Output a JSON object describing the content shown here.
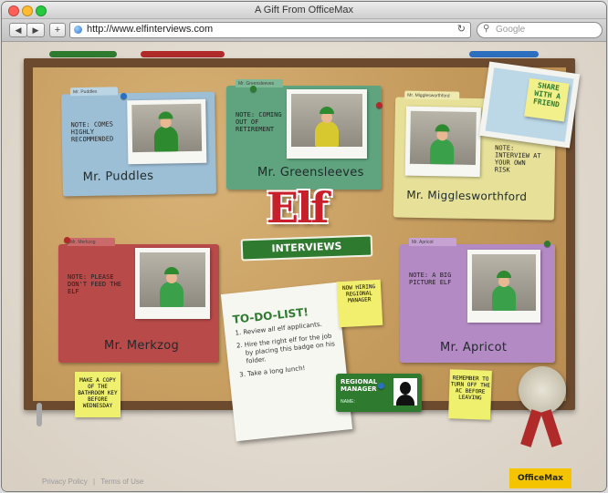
{
  "window": {
    "title": "A Gift From OfficeMax",
    "traffic_colors": [
      "#ff5f57",
      "#febc2e",
      "#28c840"
    ]
  },
  "toolbar": {
    "back_icon": "back-arrow-icon",
    "forward_icon": "forward-arrow-icon",
    "add_label": "+",
    "url": "http://www.elfinterviews.com",
    "reload_icon": "reload-icon",
    "search_placeholder": "Google"
  },
  "brand": {
    "logo_text": "Elf",
    "banner_text": "INTERVIEWS"
  },
  "share": {
    "text": "SHARE WITH A FRIEND"
  },
  "folders": [
    {
      "tab": "Mr. Puddles",
      "note": "NOTE: COMES HIGHLY RECOMMENDED",
      "name": "Mr. Puddles",
      "color": "#9dbfd6"
    },
    {
      "tab": "Mr. Greensleeves",
      "note": "NOTE: COMING OUT OF RETIREMENT",
      "name": "Mr. Greensleeves",
      "color": "#5fa47f"
    },
    {
      "tab": "Mr. Migglesworthford",
      "note": "NOTE: INTERVIEW AT YOUR OWN RISK",
      "name": "Mr. Migglesworthford",
      "color": "#e6e098"
    },
    {
      "tab": "Mr. Merkzog",
      "note": "NOTE: PLEASE DON'T FEED THE ELF",
      "name": "Mr. Merkzog",
      "color": "#b84a4a"
    },
    {
      "tab": "Mr. Apricot",
      "note": "NOTE: A BIG PICTURE ELF",
      "name": "Mr. Apricot",
      "color": "#b48ac4"
    }
  ],
  "todo": {
    "title": "TO-DO-LIST!",
    "items": [
      "Review all elf applicants.",
      "Hire the right elf for the job by placing this badge on his folder.",
      "Take a long lunch!"
    ]
  },
  "stickies": {
    "now_hiring": "NOW HIRING REGIONAL MANAGER",
    "bathroom_key": "MAKE A COPY OF THE BATHROOM KEY BEFORE WEDNESDAY",
    "ac": "REMEMBER TO TURN OFF THE AC BEFORE LEAVING"
  },
  "badge": {
    "title": "REGIONAL MANAGER",
    "name_label": "NAME:"
  },
  "footer": {
    "privacy": "Privacy Policy",
    "separator": "|",
    "terms": "Terms of Use"
  },
  "officemax": {
    "label": "OfficeMax"
  }
}
